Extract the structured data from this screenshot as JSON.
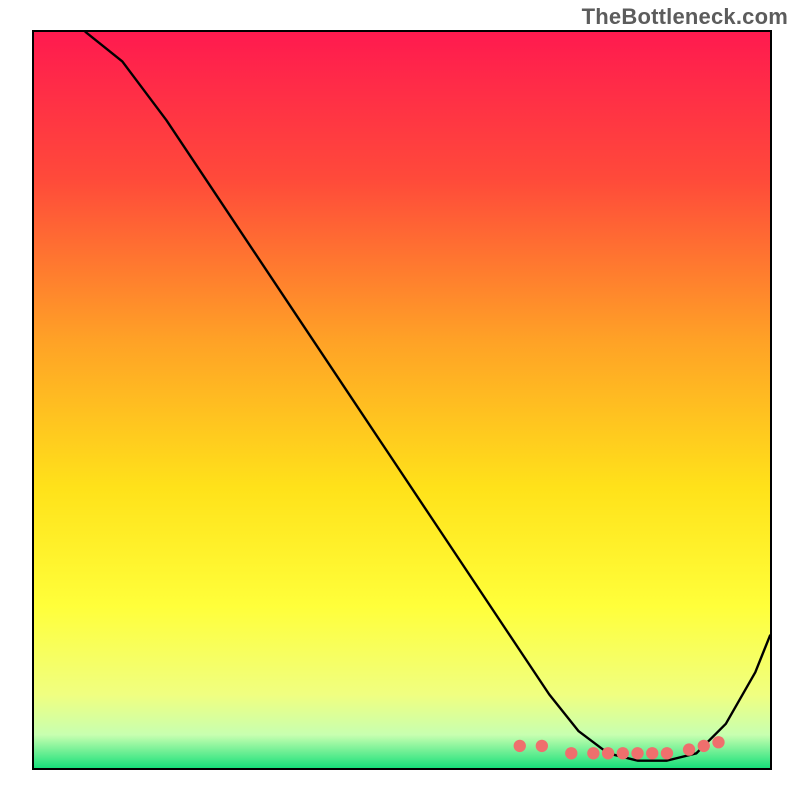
{
  "watermark": "TheBottleneck.com",
  "chart_data": {
    "type": "line",
    "title": "",
    "xlabel": "",
    "ylabel": "",
    "has_axis_ticks": false,
    "has_grid": false,
    "has_legend": false,
    "plot_note": "No axis labels or ticks are visible; values below are normalized 0–100 read off the figure.",
    "xlim": [
      0,
      100
    ],
    "ylim": [
      0,
      100
    ],
    "background_gradient": {
      "direction": "vertical",
      "stops": [
        {
          "pos": 0.0,
          "color": "#ff1a4f"
        },
        {
          "pos": 0.2,
          "color": "#ff4a3a"
        },
        {
          "pos": 0.42,
          "color": "#ffa226"
        },
        {
          "pos": 0.62,
          "color": "#ffe21a"
        },
        {
          "pos": 0.78,
          "color": "#ffff3a"
        },
        {
          "pos": 0.9,
          "color": "#f0ff80"
        },
        {
          "pos": 0.955,
          "color": "#c8ffb0"
        },
        {
          "pos": 1.0,
          "color": "#18e07a"
        }
      ]
    },
    "series": [
      {
        "name": "bottleneck-curve",
        "color": "#000000",
        "x": [
          7,
          12,
          18,
          24,
          30,
          36,
          42,
          48,
          54,
          60,
          66,
          70,
          74,
          78,
          82,
          86,
          90,
          94,
          98,
          100
        ],
        "y": [
          100,
          96,
          88,
          79,
          70,
          61,
          52,
          43,
          34,
          25,
          16,
          10,
          5,
          2,
          1,
          1,
          2,
          6,
          13,
          18
        ]
      }
    ],
    "highlight_points": {
      "name": "optimal-range-markers",
      "color": "#ef6f6d",
      "x": [
        66,
        69,
        73,
        76,
        78,
        80,
        82,
        84,
        86,
        89,
        91,
        93
      ],
      "y": [
        3,
        3,
        2,
        2,
        2,
        2,
        2,
        2,
        2,
        2.5,
        3,
        3.5
      ]
    }
  }
}
